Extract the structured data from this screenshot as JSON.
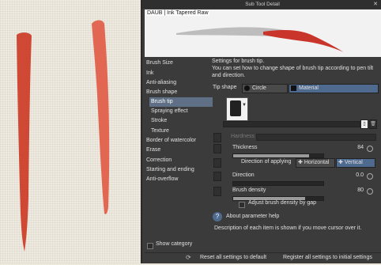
{
  "window": {
    "title": "Sub Tool Detail",
    "close": "✕"
  },
  "preview": {
    "brush_name": "DAUB | Ink Tapered Raw"
  },
  "sidebar": {
    "items": [
      {
        "label": "Brush Size"
      },
      {
        "label": "Ink"
      },
      {
        "label": "Anti-aliasing"
      },
      {
        "label": "Brush shape"
      },
      {
        "label": "Brush tip"
      },
      {
        "label": "Spraying effect"
      },
      {
        "label": "Stroke"
      },
      {
        "label": "Texture"
      },
      {
        "label": "Border of watercolor"
      },
      {
        "label": "Erase"
      },
      {
        "label": "Correction"
      },
      {
        "label": "Starting and ending"
      },
      {
        "label": "Anti-overflow"
      }
    ],
    "selected": "Brush tip",
    "show_category": "Show category"
  },
  "content": {
    "description_title": "Settings for brush tip.",
    "description_body": "You can set how to change shape of brush tip according to pen tilt and direction.",
    "tip_shape": {
      "label": "Tip shape",
      "options": [
        "Circle",
        "Material"
      ],
      "selected": "Material"
    },
    "hardness": {
      "label": "Hardness"
    },
    "thickness": {
      "label": "Thickness",
      "value": "84",
      "fill": 0.84
    },
    "direction_of_applying": {
      "label": "Direction of applying",
      "options": [
        "Horizontal",
        "Vertical"
      ],
      "selected": "Vertical"
    },
    "direction": {
      "label": "Direction",
      "value": "0.0",
      "fill": 0.0
    },
    "brush_density": {
      "label": "Brush density",
      "value": "80",
      "fill": 0.8
    },
    "adjust_density": {
      "label": "Adjust brush density by gap",
      "checked": false
    },
    "param_help": {
      "label": "About parameter help",
      "text": "Description of each item is shown if you move cursor over it."
    }
  },
  "footer": {
    "reset_all": "Reset all settings to default",
    "register_all": "Register all settings to initial settings"
  },
  "colors": {
    "panel": "#3b3b3b",
    "accent": "#4f6a8f",
    "stroke": "#cf3f2a"
  }
}
